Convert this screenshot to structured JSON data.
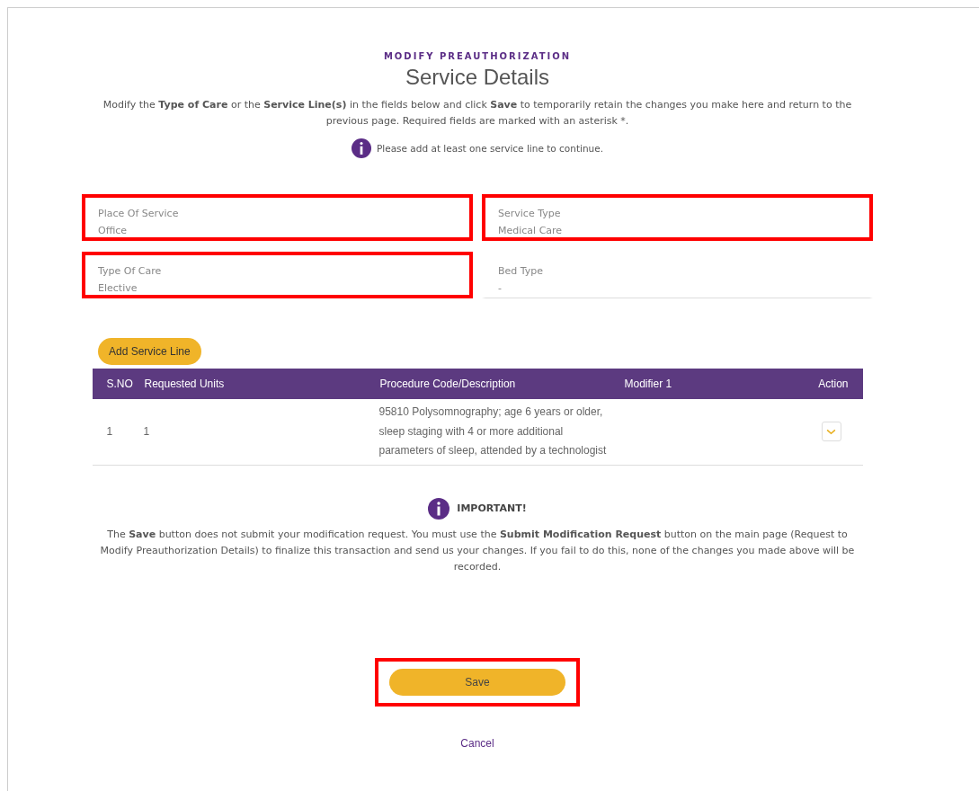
{
  "header": {
    "eyebrow": "MODIFY PREAUTHORIZATION",
    "title": "Service Details",
    "intro": "Modify the **Type of Care** or the **Service Line(s)** in the fields below and click **Save** to temporarily retain the changes you make here and return to the previous page. Required fields are marked with an asterisk *.",
    "notice": "Please add at least one service line to continue."
  },
  "fields": [
    {
      "label": "Place Of Service",
      "value": "Office",
      "highlighted": true
    },
    {
      "label": "Service Type",
      "value": "Medical Care",
      "highlighted": true
    },
    {
      "label": "Type Of Care",
      "value": "Elective",
      "highlighted": true
    },
    {
      "label": "Bed Type",
      "value": "-",
      "highlighted": false
    }
  ],
  "add_button": "Add Service Line",
  "table": {
    "columns": [
      "S.NO",
      "Requested Units",
      "Procedure Code/Description",
      "Modifier 1",
      "Action"
    ],
    "rows": [
      {
        "sno": "1",
        "units": "1",
        "procedure": "95810 Polysomnography; age 6 years or older, sleep staging with 4 or more additional parameters of sleep, attended by a technologist",
        "modifier": ""
      }
    ]
  },
  "important": {
    "title": "IMPORTANT!",
    "text": "The **Save** button does not submit your modification request. You must use the **Submit Modification Request** button on the main page (Request to Modify Preauthorization Details) to finalize this transaction and send us your changes. If you fail to do this, none of the changes you made above will be recorded."
  },
  "save_button": {
    "label": "Save",
    "highlighted": true
  },
  "cancel_link": "Cancel"
}
